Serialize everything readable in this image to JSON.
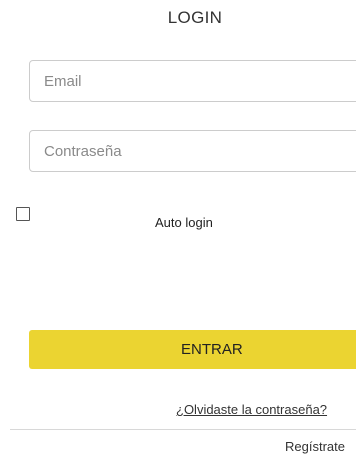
{
  "header": {
    "title": "LOGIN"
  },
  "form": {
    "email": {
      "placeholder": "Email",
      "value": ""
    },
    "password": {
      "placeholder": "Contraseña",
      "value": ""
    },
    "auto_login": {
      "label": "Auto login",
      "checked": false
    },
    "submit_label": "ENTRAR",
    "submit_color": "#ebd431"
  },
  "links": {
    "forgot_password": "¿Olvidaste la contraseña?",
    "register": "Regístrate"
  }
}
